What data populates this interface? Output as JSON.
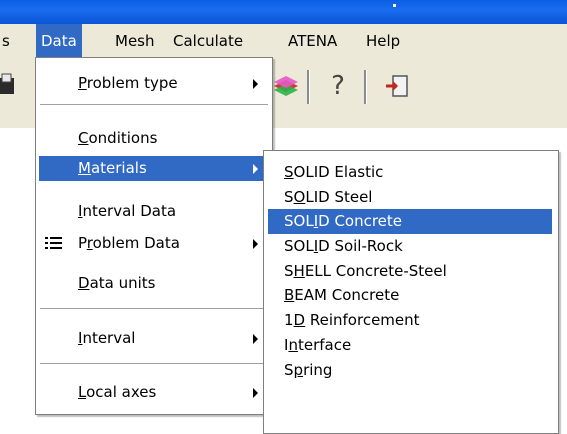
{
  "menubar": {
    "items": [
      {
        "label": "s"
      },
      {
        "label": "Data"
      },
      {
        "label": "Mesh"
      },
      {
        "label": "Calculate"
      },
      {
        "label": "ATENA"
      },
      {
        "label": "Help"
      }
    ]
  },
  "toolbar": {
    "help_glyph": "?"
  },
  "data_menu": {
    "items": [
      {
        "pre": "",
        "key": "P",
        "post": "roblem type",
        "submenu": true
      },
      {
        "pre": "",
        "key": "C",
        "post": "onditions",
        "submenu": false
      },
      {
        "pre": "",
        "key": "M",
        "post": "aterials",
        "submenu": true
      },
      {
        "pre": "",
        "key": "I",
        "post": "nterval Data",
        "submenu": false
      },
      {
        "pre": "P",
        "key": "r",
        "post": "oblem Data",
        "submenu": true,
        "icon": "list-icon"
      },
      {
        "pre": "",
        "key": "D",
        "post": "ata units",
        "submenu": false
      },
      {
        "pre": "",
        "key": "I",
        "post": "nterval",
        "submenu": true
      },
      {
        "pre": "",
        "key": "L",
        "post": "ocal axes",
        "submenu": true
      }
    ]
  },
  "materials_menu": {
    "items": [
      {
        "pre": "",
        "key": "S",
        "post": "OLID Elastic"
      },
      {
        "pre": "S",
        "key": "O",
        "post": "LID Steel"
      },
      {
        "pre": "SOL",
        "key": "I",
        "post": "D Concrete"
      },
      {
        "pre": "SOL",
        "key": "I",
        "post": "D Soil-Rock"
      },
      {
        "pre": "S",
        "key": "H",
        "post": "ELL Concrete-Steel"
      },
      {
        "pre": "",
        "key": "B",
        "post": "EAM Concrete"
      },
      {
        "pre": "1",
        "key": "D",
        "post": " Reinforcement"
      },
      {
        "pre": "I",
        "key": "n",
        "post": "terface"
      },
      {
        "pre": "S",
        "key": "p",
        "post": "ring"
      }
    ]
  },
  "colors": {
    "highlight": "#316ac5",
    "menubar_bg": "#ece9d8",
    "titlebar": "#0a5fe0"
  }
}
